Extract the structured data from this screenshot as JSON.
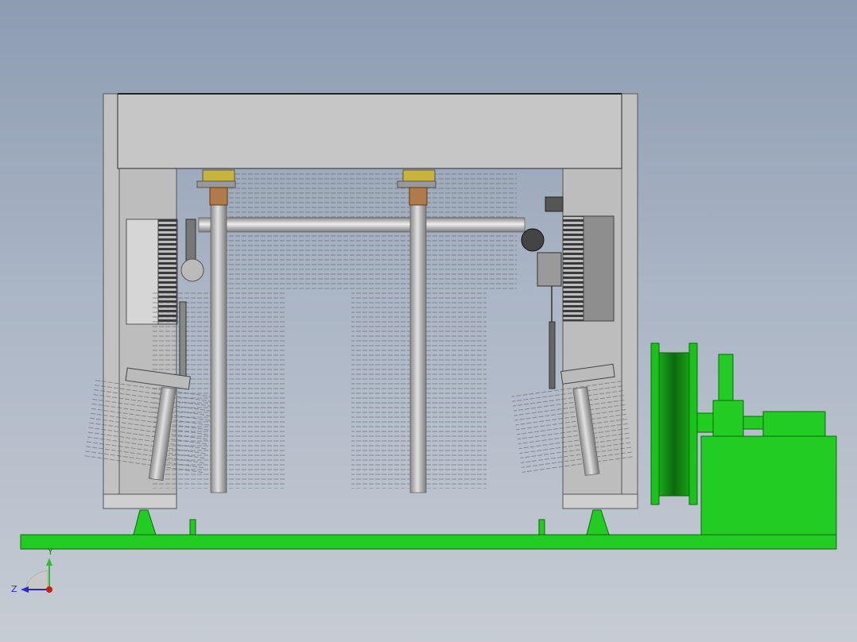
{
  "view": {
    "background_top": "#8d9cb2",
    "background_bottom": "#c7ccd4"
  },
  "colors": {
    "frame_light": "#c9c9c9",
    "frame_mid": "#b2b2b2",
    "frame_dark": "#4a4a4a",
    "panel": "#d4d4d4",
    "cabinet": "#8f8f8f",
    "roller": "#c9c9c9",
    "bracket_yellow": "#c8b43a",
    "bracket_copper": "#b07a4a",
    "motor_green": "#1cc21c",
    "motor_green_dark": "#0a7f0a",
    "base_green": "#22cc22",
    "axis_y": "#2dbf2d",
    "axis_z": "#2a2acc",
    "axis_origin": "#d01818"
  },
  "icons": {
    "triad": "coordinate-triad-icon"
  },
  "triad": {
    "y_label": "Y",
    "z_label": "Z"
  }
}
